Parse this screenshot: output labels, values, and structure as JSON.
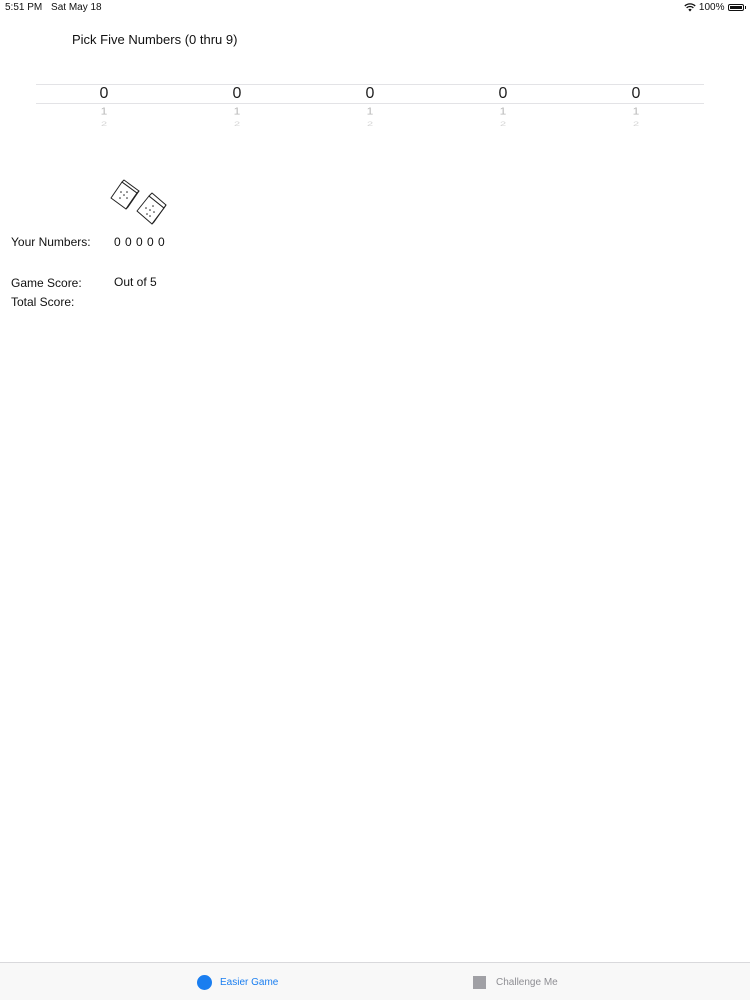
{
  "status_bar": {
    "time": "5:51 PM",
    "date": "Sat May 18",
    "battery": "100%",
    "wifi_icon": "wifi-icon",
    "battery_icon": "battery-icon"
  },
  "title": "Pick Five Numbers (0 thru 9)",
  "picker": {
    "wheels": [
      {
        "selected": "0",
        "next": "1",
        "next2": "2"
      },
      {
        "selected": "0",
        "next": "1",
        "next2": "2"
      },
      {
        "selected": "0",
        "next": "1",
        "next2": "2"
      },
      {
        "selected": "0",
        "next": "1",
        "next2": "2"
      },
      {
        "selected": "0",
        "next": "1",
        "next2": "2"
      }
    ]
  },
  "dice_icon": "dice-icon",
  "your_numbers": {
    "label": "Your Numbers:",
    "value": "0 0 0 0 0"
  },
  "game_score": {
    "label": "Game Score:",
    "value": "Out of 5"
  },
  "total_score": {
    "label": "Total Score:"
  },
  "tab_bar": {
    "accent": "#1a7ef0",
    "tabs": [
      {
        "label": "Easier Game",
        "icon": "circle-icon",
        "selected": true
      },
      {
        "label": "Challenge Me",
        "icon": "square-icon",
        "selected": false
      }
    ]
  }
}
